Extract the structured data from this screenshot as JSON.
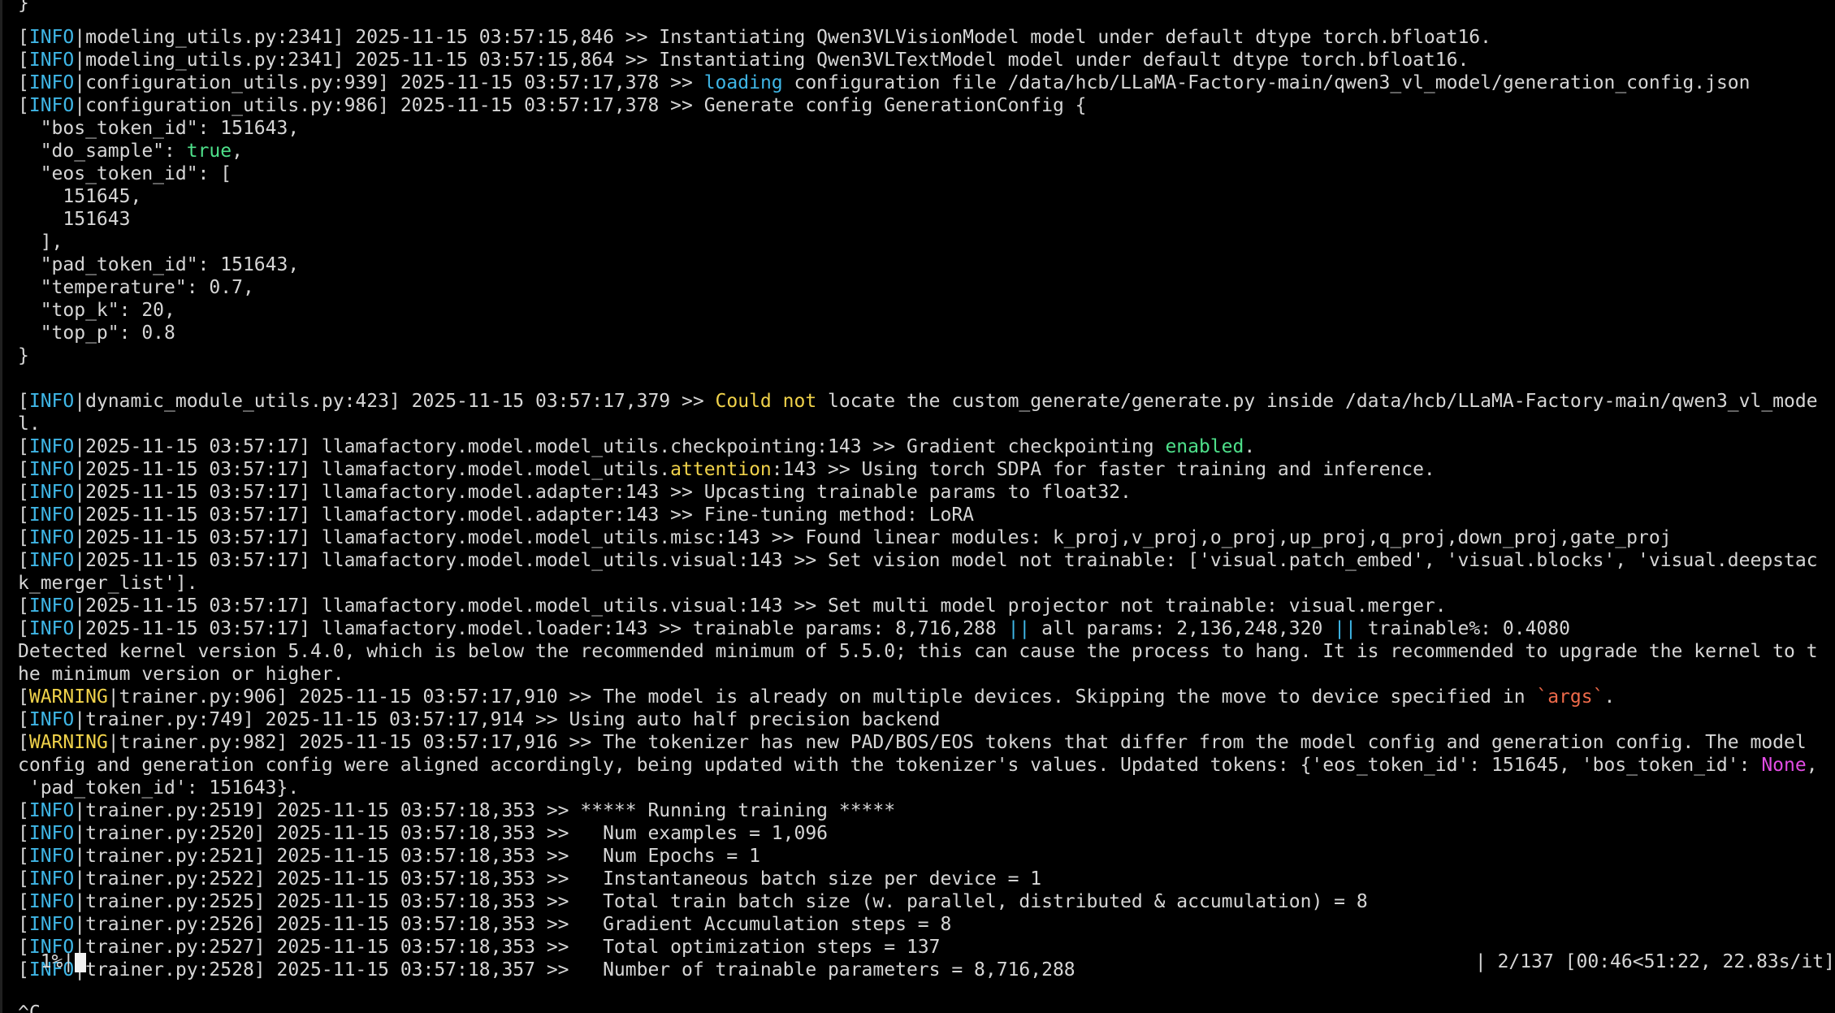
{
  "theme": {
    "background": "#000000",
    "foreground": "#d6d6d6",
    "cyan": "#3fb6e6",
    "green": "#4ee08a",
    "yellow": "#f0d24a",
    "orange": "#ee6a4a",
    "magenta": "#e24ce4",
    "progress_fill": "#f2f2f2"
  },
  "terminal": {
    "top_partial": "}",
    "lines": [
      [
        [
          "[",
          "d"
        ],
        [
          "INFO",
          "cyan"
        ],
        [
          "|modeling_utils.py:2341] 2025-11-15 03:57:15,846 >> Instantiating Qwen3VLVisionModel model under default dtype torch.bfloat16.",
          "d"
        ]
      ],
      [
        [
          "[",
          "d"
        ],
        [
          "INFO",
          "cyan"
        ],
        [
          "|modeling_utils.py:2341] 2025-11-15 03:57:15,864 >> Instantiating Qwen3VLTextModel model under default dtype torch.bfloat16.",
          "d"
        ]
      ],
      [
        [
          "[",
          "d"
        ],
        [
          "INFO",
          "cyan"
        ],
        [
          "|configuration_utils.py:939] 2025-11-15 03:57:17,378 >> ",
          "d"
        ],
        [
          "loading",
          "cyan"
        ],
        [
          " configuration file /data/hcb/LLaMA-Factory-main/qwen3_vl_model/generation_config.json",
          "d"
        ]
      ],
      [
        [
          "[",
          "d"
        ],
        [
          "INFO",
          "cyan"
        ],
        [
          "|configuration_utils.py:986] 2025-11-15 03:57:17,378 >> Generate config GenerationConfig {",
          "d"
        ]
      ],
      [
        [
          "  \"bos_token_id\": 151643,",
          "d"
        ]
      ],
      [
        [
          "  \"do_sample\": ",
          "d"
        ],
        [
          "true",
          "green"
        ],
        [
          ",",
          "d"
        ]
      ],
      [
        [
          "  \"eos_token_id\": [",
          "d"
        ]
      ],
      [
        [
          "    151645,",
          "d"
        ]
      ],
      [
        [
          "    151643",
          "d"
        ]
      ],
      [
        [
          "  ],",
          "d"
        ]
      ],
      [
        [
          "  \"pad_token_id\": 151643,",
          "d"
        ]
      ],
      [
        [
          "  \"temperature\": 0.7,",
          "d"
        ]
      ],
      [
        [
          "  \"top_k\": 20,",
          "d"
        ]
      ],
      [
        [
          "  \"top_p\": 0.8",
          "d"
        ]
      ],
      [
        [
          "}",
          "d"
        ]
      ],
      [
        [
          "",
          "d"
        ]
      ],
      [
        [
          "[",
          "d"
        ],
        [
          "INFO",
          "cyan"
        ],
        [
          "|dynamic_module_utils.py:423] 2025-11-15 03:57:17,379 >> ",
          "d"
        ],
        [
          "Could not",
          "yellow"
        ],
        [
          " locate the custom_generate/generate.py inside /data/hcb/LLaMA-Factory-main/qwen3_vl_mode",
          "d"
        ]
      ],
      [
        [
          "l.",
          "d"
        ]
      ],
      [
        [
          "[",
          "d"
        ],
        [
          "INFO",
          "cyan"
        ],
        [
          "|2025-11-15 03:57:17] llamafactory.model.model_utils.checkpointing:143 >> Gradient checkpointing ",
          "d"
        ],
        [
          "enabled",
          "green"
        ],
        [
          ".",
          "d"
        ]
      ],
      [
        [
          "[",
          "d"
        ],
        [
          "INFO",
          "cyan"
        ],
        [
          "|2025-11-15 03:57:17] llamafactory.model.model_utils.",
          "d"
        ],
        [
          "attention",
          "yellow"
        ],
        [
          ":143 >> Using torch SDPA for faster training and inference.",
          "d"
        ]
      ],
      [
        [
          "[",
          "d"
        ],
        [
          "INFO",
          "cyan"
        ],
        [
          "|2025-11-15 03:57:17] llamafactory.model.adapter:143 >> Upcasting trainable params to float32.",
          "d"
        ]
      ],
      [
        [
          "[",
          "d"
        ],
        [
          "INFO",
          "cyan"
        ],
        [
          "|2025-11-15 03:57:17] llamafactory.model.adapter:143 >> Fine-tuning method: LoRA",
          "d"
        ]
      ],
      [
        [
          "[",
          "d"
        ],
        [
          "INFO",
          "cyan"
        ],
        [
          "|2025-11-15 03:57:17] llamafactory.model.model_utils.misc:143 >> Found linear modules: k_proj,v_proj,o_proj,up_proj,q_proj,down_proj,gate_proj",
          "d"
        ]
      ],
      [
        [
          "[",
          "d"
        ],
        [
          "INFO",
          "cyan"
        ],
        [
          "|2025-11-15 03:57:17] llamafactory.model.model_utils.visual:143 >> Set vision model not trainable: ['visual.patch_embed', 'visual.blocks', 'visual.deepstac",
          "d"
        ]
      ],
      [
        [
          "k_merger_list'].",
          "d"
        ]
      ],
      [
        [
          "[",
          "d"
        ],
        [
          "INFO",
          "cyan"
        ],
        [
          "|2025-11-15 03:57:17] llamafactory.model.model_utils.visual:143 >> Set multi model projector not trainable: visual.merger.",
          "d"
        ]
      ],
      [
        [
          "[",
          "d"
        ],
        [
          "INFO",
          "cyan"
        ],
        [
          "|2025-11-15 03:57:17] llamafactory.model.loader:143 >> trainable params: 8,716,288 ",
          "d"
        ],
        [
          "||",
          "cyan"
        ],
        [
          " all params: 2,136,248,320 ",
          "d"
        ],
        [
          "||",
          "cyan"
        ],
        [
          " trainable%: 0.4080",
          "d"
        ]
      ],
      [
        [
          "Detected kernel version 5.4.0, which is below the recommended minimum of 5.5.0; this can cause the process to hang. It is recommended to upgrade the kernel to t",
          "d"
        ]
      ],
      [
        [
          "he minimum version or higher.",
          "d"
        ]
      ],
      [
        [
          "[",
          "d"
        ],
        [
          "WARNING",
          "yellow"
        ],
        [
          "|trainer.py:906] 2025-11-15 03:57:17,910 >> The model is already on multiple devices. Skipping the move to device specified in ",
          "d"
        ],
        [
          "`args`",
          "orange"
        ],
        [
          ".",
          "d"
        ]
      ],
      [
        [
          "[",
          "d"
        ],
        [
          "INFO",
          "cyan"
        ],
        [
          "|trainer.py:749] 2025-11-15 03:57:17,914 >> Using auto half precision backend",
          "d"
        ]
      ],
      [
        [
          "[",
          "d"
        ],
        [
          "WARNING",
          "yellow"
        ],
        [
          "|trainer.py:982] 2025-11-15 03:57:17,916 >> The tokenizer has new PAD/BOS/EOS tokens that differ from the model config and generation config. The model",
          "d"
        ]
      ],
      [
        [
          "config and generation config were aligned accordingly, being updated with the tokenizer's values. Updated tokens: {'eos_token_id': 151645, 'bos_token_id': ",
          "d"
        ],
        [
          "None",
          "magenta"
        ],
        [
          ",",
          "d"
        ]
      ],
      [
        [
          " 'pad_token_id': 151643}.",
          "d"
        ]
      ],
      [
        [
          "[",
          "d"
        ],
        [
          "INFO",
          "cyan"
        ],
        [
          "|trainer.py:2519] 2025-11-15 03:57:18,353 >> ***** Running training *****",
          "d"
        ]
      ],
      [
        [
          "[",
          "d"
        ],
        [
          "INFO",
          "cyan"
        ],
        [
          "|trainer.py:2520] 2025-11-15 03:57:18,353 >>   Num examples = 1,096",
          "d"
        ]
      ],
      [
        [
          "[",
          "d"
        ],
        [
          "INFO",
          "cyan"
        ],
        [
          "|trainer.py:2521] 2025-11-15 03:57:18,353 >>   Num Epochs = 1",
          "d"
        ]
      ],
      [
        [
          "[",
          "d"
        ],
        [
          "INFO",
          "cyan"
        ],
        [
          "|trainer.py:2522] 2025-11-15 03:57:18,353 >>   Instantaneous batch size per device = 1",
          "d"
        ]
      ],
      [
        [
          "[",
          "d"
        ],
        [
          "INFO",
          "cyan"
        ],
        [
          "|trainer.py:2525] 2025-11-15 03:57:18,353 >>   Total train batch size (w. parallel, distributed & accumulation) = 8",
          "d"
        ]
      ],
      [
        [
          "[",
          "d"
        ],
        [
          "INFO",
          "cyan"
        ],
        [
          "|trainer.py:2526] 2025-11-15 03:57:18,353 >>   Gradient Accumulation steps = 8",
          "d"
        ]
      ],
      [
        [
          "[",
          "d"
        ],
        [
          "INFO",
          "cyan"
        ],
        [
          "|trainer.py:2527] 2025-11-15 03:57:18,353 >>   Total optimization steps = 137",
          "d"
        ]
      ],
      [
        [
          "[",
          "d"
        ],
        [
          "INFO",
          "cyan"
        ],
        [
          "|trainer.py:2528] 2025-11-15 03:57:18,357 >>   Number of trainable parameters = 8,716,288",
          "d"
        ]
      ]
    ]
  },
  "progress": {
    "prefix": "  1%|",
    "fraction": 0.0146,
    "suffix": "| 2/137 [00:46<51:22, 22.83s/it]"
  },
  "bottom_partial": "^C"
}
